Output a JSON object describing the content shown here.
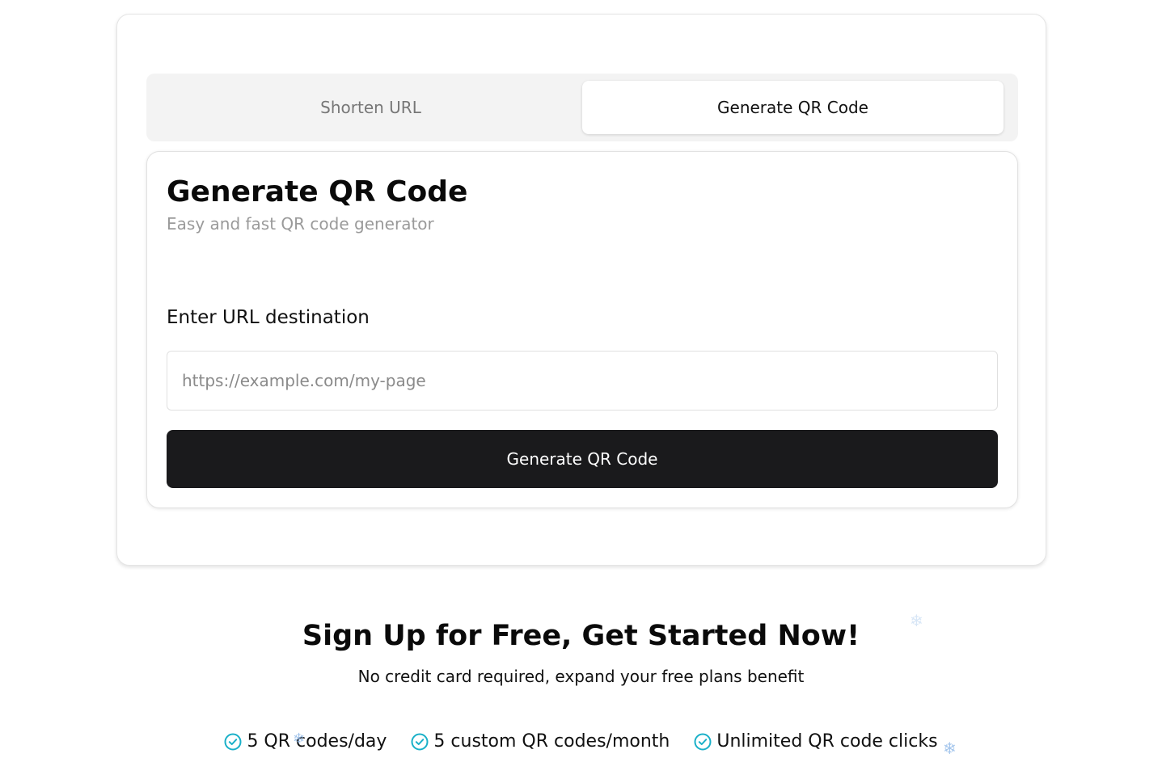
{
  "tabs": [
    {
      "label": "Shorten URL",
      "active": false
    },
    {
      "label": "Generate QR Code",
      "active": true
    }
  ],
  "form": {
    "title": "Generate QR Code",
    "subtitle": "Easy and fast QR code generator",
    "field_label": "Enter URL destination",
    "input_value": "",
    "input_placeholder": "https://example.com/my-page",
    "button_label": "Generate QR Code"
  },
  "signup": {
    "title": "Sign Up for Free, Get Started Now!",
    "subtitle": "No credit card required, expand your free plans benefit",
    "benefits": [
      {
        "icon": "check-circle-icon",
        "label": "5 QR codes/day"
      },
      {
        "icon": "check-circle-icon",
        "label": "5 custom QR codes/month"
      },
      {
        "icon": "check-circle-icon",
        "label": "Unlimited QR code clicks"
      }
    ]
  },
  "decorations": {
    "snowflake_glyph": "❄"
  },
  "colors": {
    "accent": "#1ab0c8",
    "primary_button": "#1a1a1c",
    "muted_text": "#9a9a9a"
  }
}
